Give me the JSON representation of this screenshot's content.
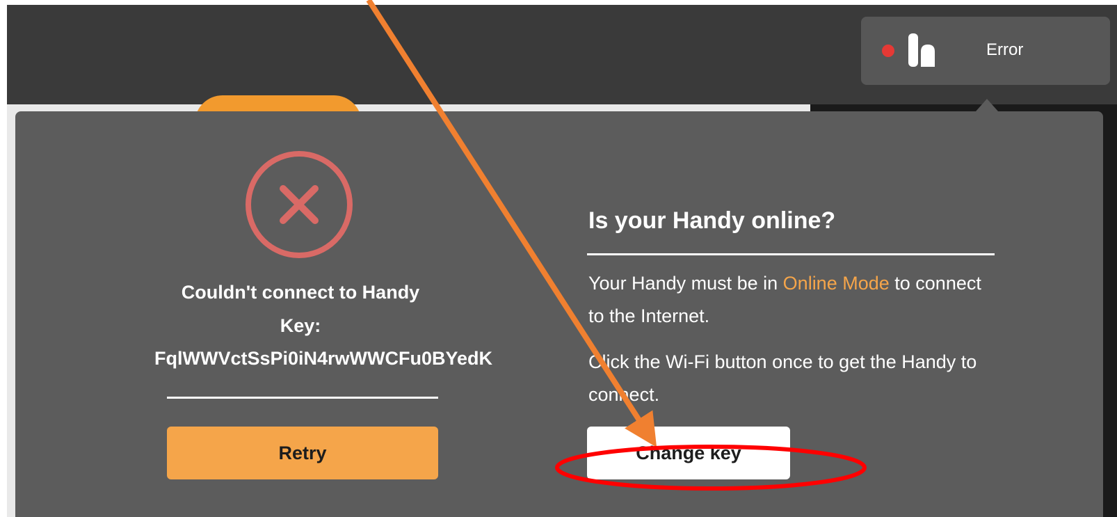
{
  "header": {
    "status_label": "Error",
    "status_color": "#e53935"
  },
  "dialog": {
    "error_line_1": "Couldn't connect to Handy",
    "error_line_2": "Key:",
    "error_key": "FqlWWVctSsPi0iN4rwWWCFu0BYedK",
    "retry_label": "Retry",
    "help_title": "Is your Handy online?",
    "help_p1_before": "Your Handy must be in ",
    "help_p1_link": "Online Mode",
    "help_p1_after": " to connect to the Internet.",
    "help_p2": "Click the Wi-Fi button once to get the Handy to connect.",
    "change_key_label": "Change key"
  },
  "colors": {
    "accent": "#f5a54a",
    "error_icon": "#d96a66",
    "annotation_arrow": "#f08030",
    "annotation_ellipse": "#ff0000"
  },
  "icons": {
    "status": "status-dot-icon",
    "logo": "handy-logo-icon",
    "error": "close-circle-icon"
  }
}
